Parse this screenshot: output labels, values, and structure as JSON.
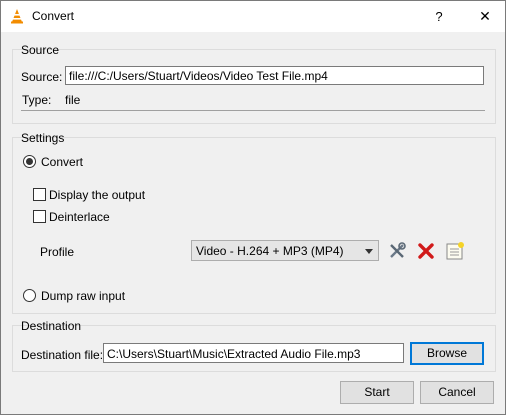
{
  "window": {
    "title": "Convert",
    "help_label": "?",
    "close_label": "✕",
    "app_icon": "vlc-cone-icon"
  },
  "source": {
    "group_label": "Source",
    "source_label": "Source:",
    "source_value": "file:///C:/Users/Stuart/Videos/Video Test File.mp4",
    "type_label": "Type:",
    "type_value": "file"
  },
  "settings": {
    "group_label": "Settings",
    "convert_label": "Convert",
    "convert_checked": true,
    "display_output_label": "Display the output",
    "display_output_checked": false,
    "deinterlace_label": "Deinterlace",
    "deinterlace_checked": false,
    "profile_label": "Profile",
    "profile_selected": "Video - H.264 + MP3 (MP4)",
    "profile_buttons": [
      "edit-profile-icon",
      "delete-profile-icon",
      "new-profile-icon"
    ],
    "dump_raw_label": "Dump raw input",
    "dump_raw_checked": false
  },
  "destination": {
    "group_label": "Destination",
    "file_label": "Destination file:",
    "file_value": "C:\\Users\\Stuart\\Music\\Extracted Audio File.mp3",
    "browse_label": "Browse"
  },
  "actions": {
    "start_label": "Start",
    "cancel_label": "Cancel"
  },
  "colors": {
    "focus_accent": "#0078d7",
    "delete_red": "#d11a1a"
  }
}
